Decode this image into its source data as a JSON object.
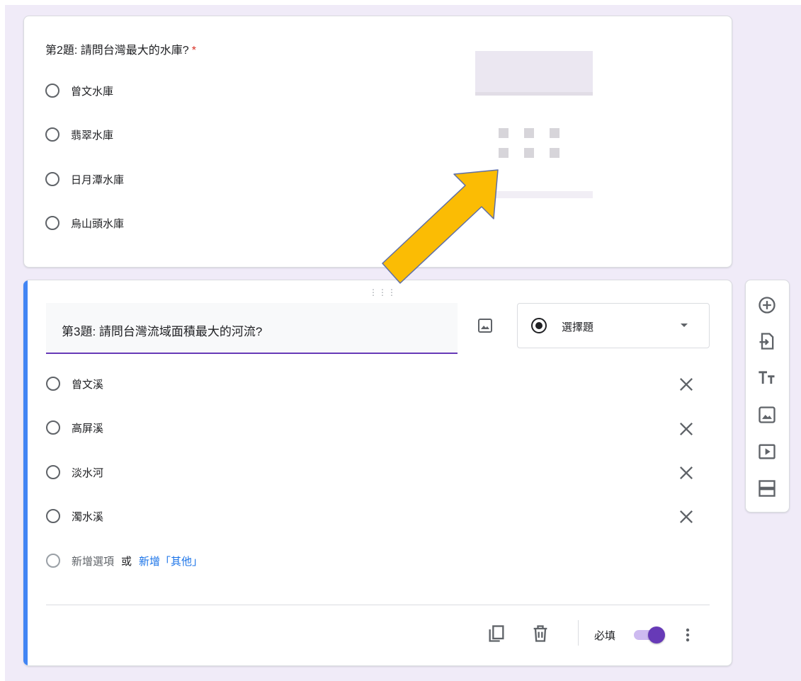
{
  "question2": {
    "title": "第2題: 請問台灣最大的水庫?",
    "required_mark": "*",
    "options": [
      "曾文水庫",
      "翡翠水庫",
      "日月潭水庫",
      "烏山頭水庫"
    ]
  },
  "question3": {
    "title": "第3題: 請問台灣流域面積最大的河流?",
    "type_label": "選擇題",
    "options": [
      "曾文溪",
      "高屏溪",
      "淡水河",
      "濁水溪"
    ],
    "add_option": "新增選項",
    "or_text": "或",
    "add_other": "新增「其他」",
    "required_label": "必填",
    "required_on": true
  },
  "toolbar": {
    "icons": [
      "add-question-icon",
      "import-questions-icon",
      "add-title-icon",
      "add-image-icon",
      "add-video-icon",
      "add-section-icon"
    ]
  },
  "colors": {
    "accent": "#673ab7",
    "active_bar": "#4285f4",
    "arrow": "#fbbc04",
    "link": "#1a73e8",
    "required": "#d93025",
    "background": "#f0ebf8"
  }
}
